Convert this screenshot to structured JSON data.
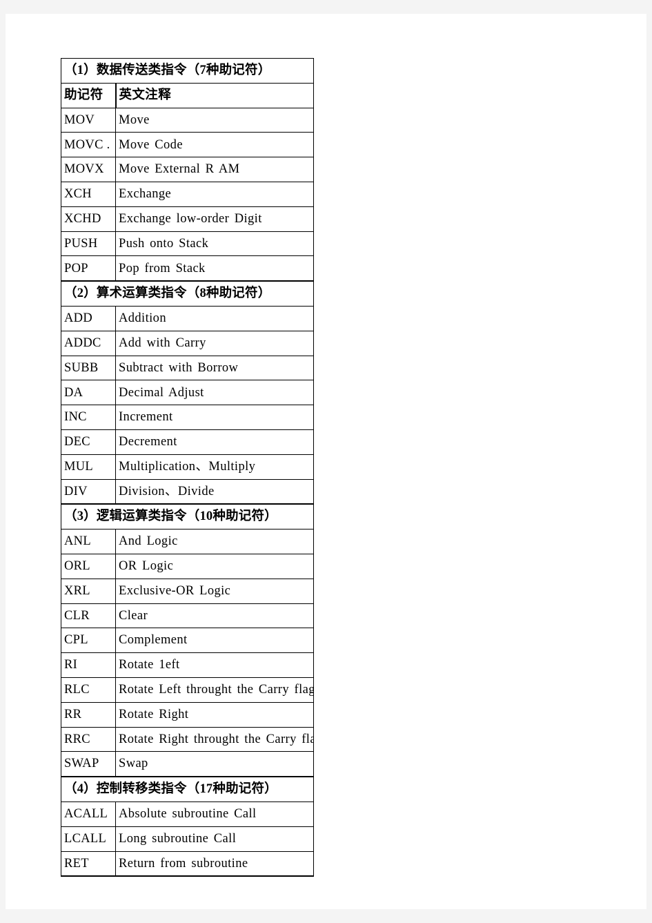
{
  "document": {
    "columns": {
      "mnemonic": "助记符",
      "english": "英文注释"
    },
    "sections": [
      {
        "title": "（1）数据传送类指令（7种助记符）",
        "show_column_header": true,
        "rows": [
          {
            "mnemonic": "MOV",
            "english": "Move"
          },
          {
            "mnemonic": "MOVC .",
            "english": "Move  Code"
          },
          {
            "mnemonic": "MOVX",
            "english": "Move  External  R  AM"
          },
          {
            "mnemonic": "XCH",
            "english": "Exchange"
          },
          {
            "mnemonic": "XCHD",
            "english": "Exchange  low-order  Digit"
          },
          {
            "mnemonic": "PUSH",
            "english": "Push  onto  Stack"
          },
          {
            "mnemonic": "POP",
            "english": "Pop  from  Stack"
          }
        ]
      },
      {
        "title": "（2）算术运算类指令（8种助记符）",
        "show_column_header": false,
        "rows": [
          {
            "mnemonic": "ADD",
            "english": "Addition"
          },
          {
            "mnemonic": "ADDC",
            "english": "Add  with  Carry"
          },
          {
            "mnemonic": "SUBB",
            "english": "Subtract  with  Borrow"
          },
          {
            "mnemonic": "DA",
            "english": "Decimal  Adjust"
          },
          {
            "mnemonic": "INC",
            "english": "Increment"
          },
          {
            "mnemonic": "DEC",
            "english": "Decrement"
          },
          {
            "mnemonic": "MUL",
            "english": "Multiplication、Multiply"
          },
          {
            "mnemonic": "DIV",
            "english": "Division、Divide"
          }
        ]
      },
      {
        "title": "（3）逻辑运算类指令（10种助记符）",
        "show_column_header": false,
        "rows": [
          {
            "mnemonic": "ANL",
            "english": "And  Logic"
          },
          {
            "mnemonic": "ORL",
            "english": "OR  Logic"
          },
          {
            "mnemonic": "XRL",
            "english": "Exclusive-OR  Logic"
          },
          {
            "mnemonic": "CLR",
            "english": "Clear"
          },
          {
            "mnemonic": "CPL",
            "english": "Complement"
          },
          {
            "mnemonic": "RI",
            "english": "Rotate  1eft"
          },
          {
            "mnemonic": "RLC",
            "english": "Rotate  Left  throught  the  Carry  flag"
          },
          {
            "mnemonic": "RR",
            "english": "Rotate  Right"
          },
          {
            "mnemonic": "RRC",
            "english": "Rotate  Right  throught  the  Carry  flag"
          },
          {
            "mnemonic": "SWAP",
            "english": "Swap"
          }
        ]
      },
      {
        "title": "（4）控制转移类指令（17种助记符）",
        "show_column_header": false,
        "rows": [
          {
            "mnemonic": "ACALL",
            "english": "Absolute  subroutine  Call"
          },
          {
            "mnemonic": "LCALL",
            "english": "Long  subroutine  Call"
          },
          {
            "mnemonic": "RET",
            "english": "Return  from  subroutine"
          }
        ]
      }
    ]
  }
}
